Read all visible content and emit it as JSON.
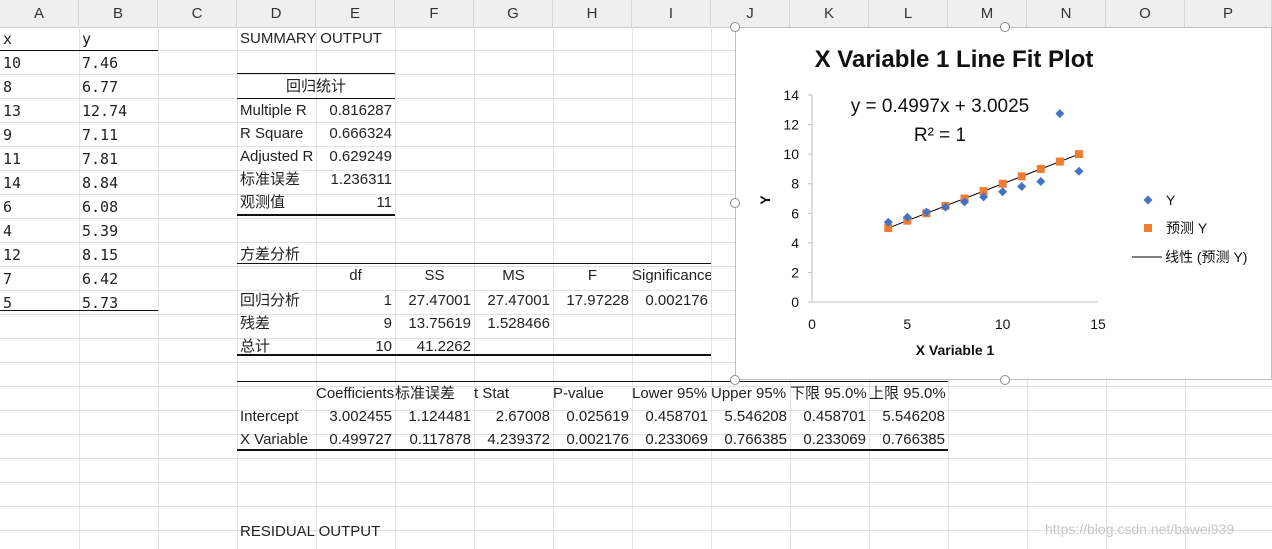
{
  "columns": [
    "A",
    "B",
    "C",
    "D",
    "E",
    "F",
    "G",
    "H",
    "I",
    "J",
    "K",
    "L",
    "M",
    "N",
    "O",
    "P"
  ],
  "data_columns": {
    "x_header": "x",
    "y_header": "y",
    "rows": [
      [
        "10",
        "7.46"
      ],
      [
        "8",
        "6.77"
      ],
      [
        "13",
        "12.74"
      ],
      [
        "9",
        "7.11"
      ],
      [
        "11",
        "7.81"
      ],
      [
        "14",
        "8.84"
      ],
      [
        "6",
        "6.08"
      ],
      [
        "4",
        "5.39"
      ],
      [
        "12",
        "8.15"
      ],
      [
        "7",
        "6.42"
      ],
      [
        "5",
        "5.73"
      ]
    ]
  },
  "summary": {
    "title": "SUMMARY OUTPUT",
    "reg_stats_header": "回归统计",
    "reg_stats": [
      [
        "Multiple R",
        "0.816287"
      ],
      [
        "R Square",
        "0.666324"
      ],
      [
        "Adjusted R",
        "0.629249"
      ],
      [
        "标准误差",
        "1.236311"
      ],
      [
        "观测值",
        "11"
      ]
    ],
    "anova_title": "方差分析",
    "anova_headers": [
      "df",
      "SS",
      "MS",
      "F",
      "Significance F"
    ],
    "anova_rows": [
      [
        "回归分析",
        "1",
        "27.47001",
        "27.47001",
        "17.97228",
        "0.002176"
      ],
      [
        "残差",
        "9",
        "13.75619",
        "1.528466",
        "",
        ""
      ],
      [
        "总计",
        "10",
        "41.2262",
        "",
        "",
        ""
      ]
    ],
    "coef_headers": [
      "Coefficients",
      "标准误差",
      "t Stat",
      "P-value",
      "Lower 95%",
      "Upper 95%",
      "下限 95.0%",
      "上限 95.0%"
    ],
    "coef_rows": [
      [
        "Intercept",
        "3.002455",
        "1.124481",
        "2.67008",
        "0.025619",
        "0.458701",
        "5.546208",
        "0.458701",
        "5.546208"
      ],
      [
        "X Variable",
        "0.499727",
        "0.117878",
        "4.239372",
        "0.002176",
        "0.233069",
        "0.766385",
        "0.233069",
        "0.766385"
      ]
    ],
    "residual_title": "RESIDUAL OUTPUT"
  },
  "chart_data": {
    "type": "scatter",
    "title": "X Variable 1 Line Fit  Plot",
    "xlabel": "X Variable 1",
    "ylabel": "Y",
    "xlim": [
      0,
      15
    ],
    "ylim": [
      0,
      14
    ],
    "xticks": [
      0,
      5,
      10,
      15
    ],
    "yticks": [
      0,
      2,
      4,
      6,
      8,
      10,
      12,
      14
    ],
    "equation": "y = 0.4997x + 3.0025",
    "r2": "R² = 1",
    "legend_position": "right",
    "series": [
      {
        "name": "Y",
        "marker": "diamond",
        "color": "#4472c4",
        "x": [
          10,
          8,
          13,
          9,
          11,
          14,
          6,
          4,
          12,
          7,
          5
        ],
        "y": [
          7.46,
          6.77,
          12.74,
          7.11,
          7.81,
          8.84,
          6.08,
          5.39,
          8.15,
          6.42,
          5.73
        ]
      },
      {
        "name": "预测 Y",
        "marker": "square",
        "color": "#ed7d31",
        "x": [
          10,
          8,
          13,
          9,
          11,
          14,
          6,
          4,
          12,
          7,
          5
        ],
        "y": [
          7.9997,
          7.0003,
          9.4989,
          7.5,
          8.4995,
          9.9986,
          6.0008,
          5.0014,
          8.9992,
          6.5006,
          5.5011
        ]
      },
      {
        "name": "线性 (预测 Y)",
        "marker": "line",
        "color": "#000000",
        "x": [
          4,
          14
        ],
        "y": [
          5.0014,
          9.9986
        ]
      }
    ]
  },
  "watermark": "https://blog.csdn.net/bawei939"
}
